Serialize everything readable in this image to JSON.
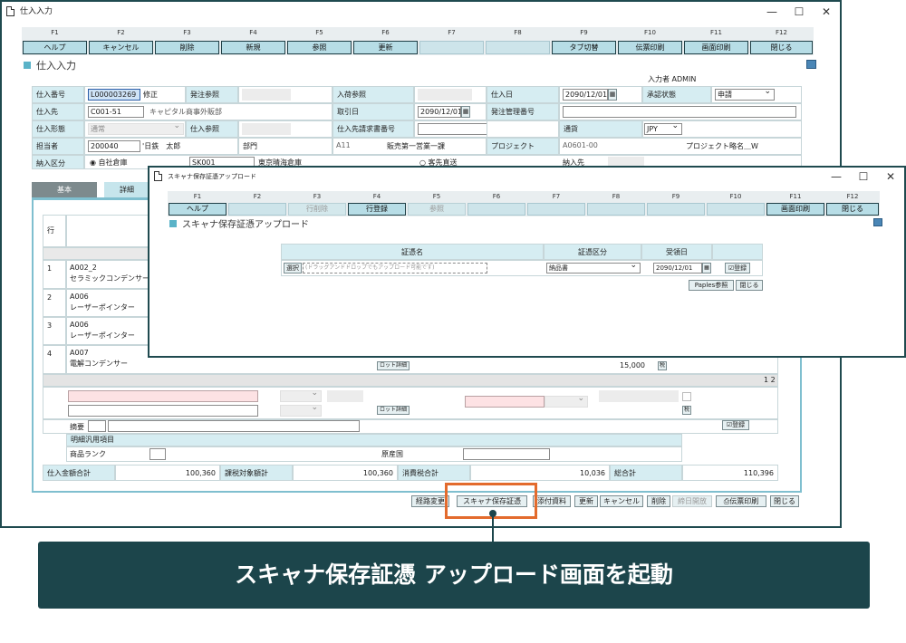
{
  "main": {
    "title": "仕入入力",
    "fkeys": [
      {
        "num": "F1",
        "label": "ヘルプ"
      },
      {
        "num": "F2",
        "label": "キャンセル"
      },
      {
        "num": "F3",
        "label": "削除"
      },
      {
        "num": "F4",
        "label": "新規"
      },
      {
        "num": "F5",
        "label": "参照"
      },
      {
        "num": "F6",
        "label": "更新"
      },
      {
        "num": "F7",
        "label": ""
      },
      {
        "num": "F8",
        "label": ""
      },
      {
        "num": "F9",
        "label": "タブ切替"
      },
      {
        "num": "F10",
        "label": "伝票印刷"
      },
      {
        "num": "F11",
        "label": "画面印刷"
      },
      {
        "num": "F12",
        "label": "閉じる"
      }
    ],
    "section_title": "仕入入力",
    "entrant": "入力者 ADMIN",
    "header": {
      "purchase_no_label": "仕入番号",
      "purchase_no": "L000003269",
      "mode": "修正",
      "order_ref_label": "発注参照",
      "receipt_ref_label": "入荷参照",
      "purchase_date_label": "仕入日",
      "purchase_date": "2090/12/01",
      "approval_label": "承認状態",
      "approval": "申請",
      "supplier_label": "仕入先",
      "supplier_code": "C001-51",
      "supplier_name": "キャピタル商事外販部",
      "trade_date_label": "取引日",
      "trade_date": "2090/12/01",
      "order_mgmt_label": "発注管理番号",
      "purchase_type_label": "仕入形態",
      "purchase_type": "通常",
      "purchase_ref_label": "仕入参照",
      "invoice_no_label": "仕入先請求書番号",
      "currency_label": "通貨",
      "currency": "JPY",
      "staff_label": "担当者",
      "staff_code": "200040",
      "staff_name": "'日鉄　太郎",
      "dept_label": "部門",
      "dept_code": "A11",
      "dept_name": "販売第一営業一課",
      "project_label": "プロジェクト",
      "project_code": "A0601-00",
      "project_name": "プロジェクト略名＿W",
      "delivery_label": "納入区分",
      "delivery_own": "自社倉庫",
      "warehouse_code": "SK001",
      "warehouse_name": "東京晴海倉庫",
      "delivery_direct": "客先直送",
      "delivery_dest_label": "納入先"
    },
    "tabs": [
      "基本",
      "詳細"
    ],
    "table": {
      "col_row": "行",
      "rows": [
        {
          "no": "1",
          "code": "A002_2",
          "name": "セラミックコンデンサー2"
        },
        {
          "no": "2",
          "code": "A006",
          "name": "レーザーポインター"
        },
        {
          "no": "3",
          "code": "A006",
          "name": "レーザーポインター"
        },
        {
          "no": "4",
          "code": "A007",
          "name": "電解コンデンサー",
          "amount": "15,000"
        }
      ],
      "lot_label": "ロット詳細",
      "page_count": "1 2",
      "detail_btn": "税",
      "memo_label": "摘要",
      "register_btn": "登録",
      "generic_items_label": "明細汎用項目",
      "rank_label": "商品ランク",
      "origin_label": "原産国"
    },
    "totals": {
      "purchase_total_label": "仕入金額合計",
      "purchase_total": "100,360",
      "taxable_label": "課税対象額計",
      "taxable": "100,360",
      "tax_label": "消費税合計",
      "tax": "10,036",
      "grand_label": "総合計",
      "grand": "110,396"
    },
    "bottom_buttons": [
      "経路変更",
      "スキャナ保存証憑",
      "添付資料",
      "更新",
      "キャンセル",
      "削除",
      "締日開放",
      "伝票印刷",
      "閉じる"
    ]
  },
  "popup": {
    "title": "スキャナ保存証憑アップロード",
    "fkeys": [
      {
        "num": "F1",
        "label": "ヘルプ"
      },
      {
        "num": "F2",
        "label": ""
      },
      {
        "num": "F3",
        "label": "行削除"
      },
      {
        "num": "F4",
        "label": "行登録"
      },
      {
        "num": "F5",
        "label": "参照"
      },
      {
        "num": "F6",
        "label": ""
      },
      {
        "num": "F7",
        "label": ""
      },
      {
        "num": "F8",
        "label": ""
      },
      {
        "num": "F9",
        "label": ""
      },
      {
        "num": "F10",
        "label": ""
      },
      {
        "num": "F11",
        "label": "画面印刷"
      },
      {
        "num": "F12",
        "label": "閉じる"
      }
    ],
    "section_title": "スキャナ保存証憑アップロード",
    "col_doc": "証憑名",
    "col_kind": "証憑区分",
    "col_date": "受領日",
    "select_btn": "選択",
    "drop_placeholder": "(ドラッグアンドドロップでもアップロード可能です)",
    "kind_value": "納品書",
    "date_value": "2090/12/01",
    "register_btn": "登録",
    "paples_btn": "Paples参照",
    "close_btn": "閉じる"
  },
  "caption": "スキャナ保存証憑 アップロード画面を起動"
}
